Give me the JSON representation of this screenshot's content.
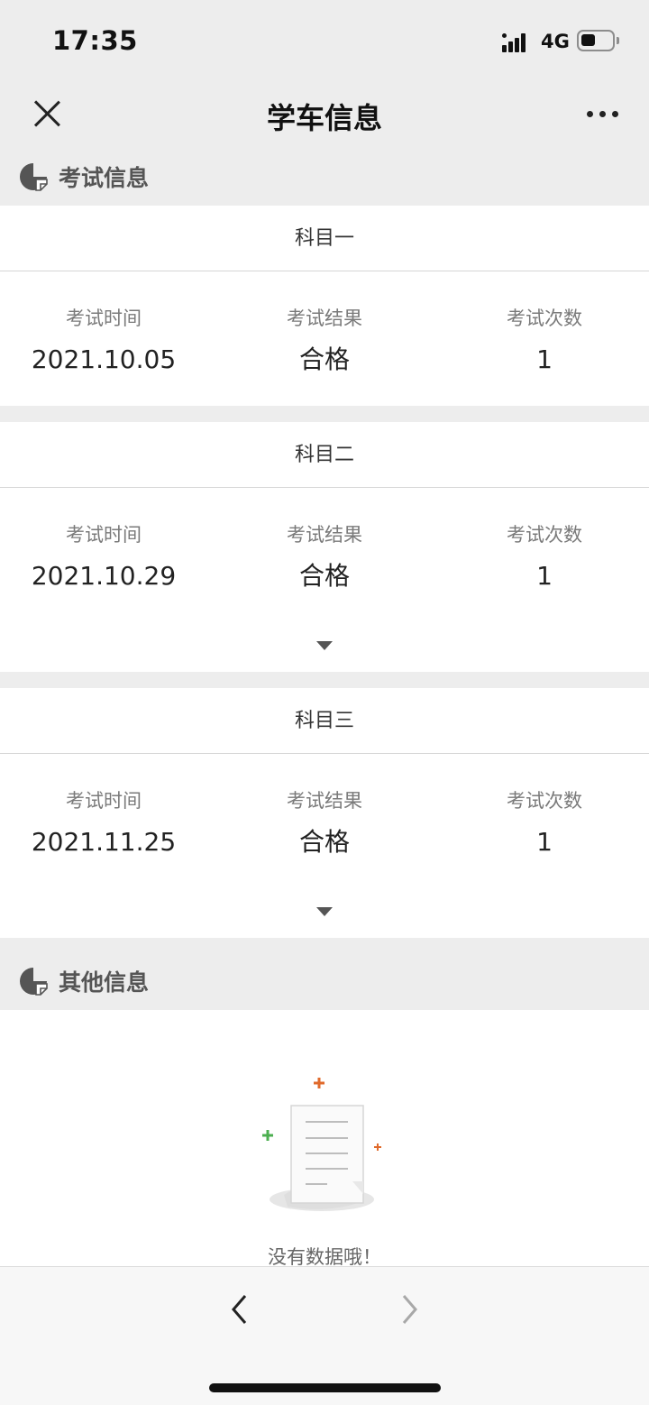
{
  "status_bar": {
    "time": "17:35",
    "network": "4G"
  },
  "nav": {
    "title": "学车信息"
  },
  "exam_section": {
    "title": "考试信息"
  },
  "subjects": [
    {
      "name": "科目一",
      "time_label": "考试时间",
      "time": "2021.10.05",
      "result_label": "考试结果",
      "result": "合格",
      "count_label": "考试次数",
      "count": "1"
    },
    {
      "name": "科目二",
      "time_label": "考试时间",
      "time": "2021.10.29",
      "result_label": "考试结果",
      "result": "合格",
      "count_label": "考试次数",
      "count": "1"
    },
    {
      "name": "科目三",
      "time_label": "考试时间",
      "time": "2021.11.25",
      "result_label": "考试结果",
      "result": "合格",
      "count_label": "考试次数",
      "count": "1"
    }
  ],
  "other_section": {
    "title": "其他信息",
    "empty_text": "没有数据哦！"
  },
  "colors": {
    "background": "#ededed",
    "card": "#ffffff",
    "accent_orange": "#e06a2b",
    "accent_green": "#4caf50"
  }
}
